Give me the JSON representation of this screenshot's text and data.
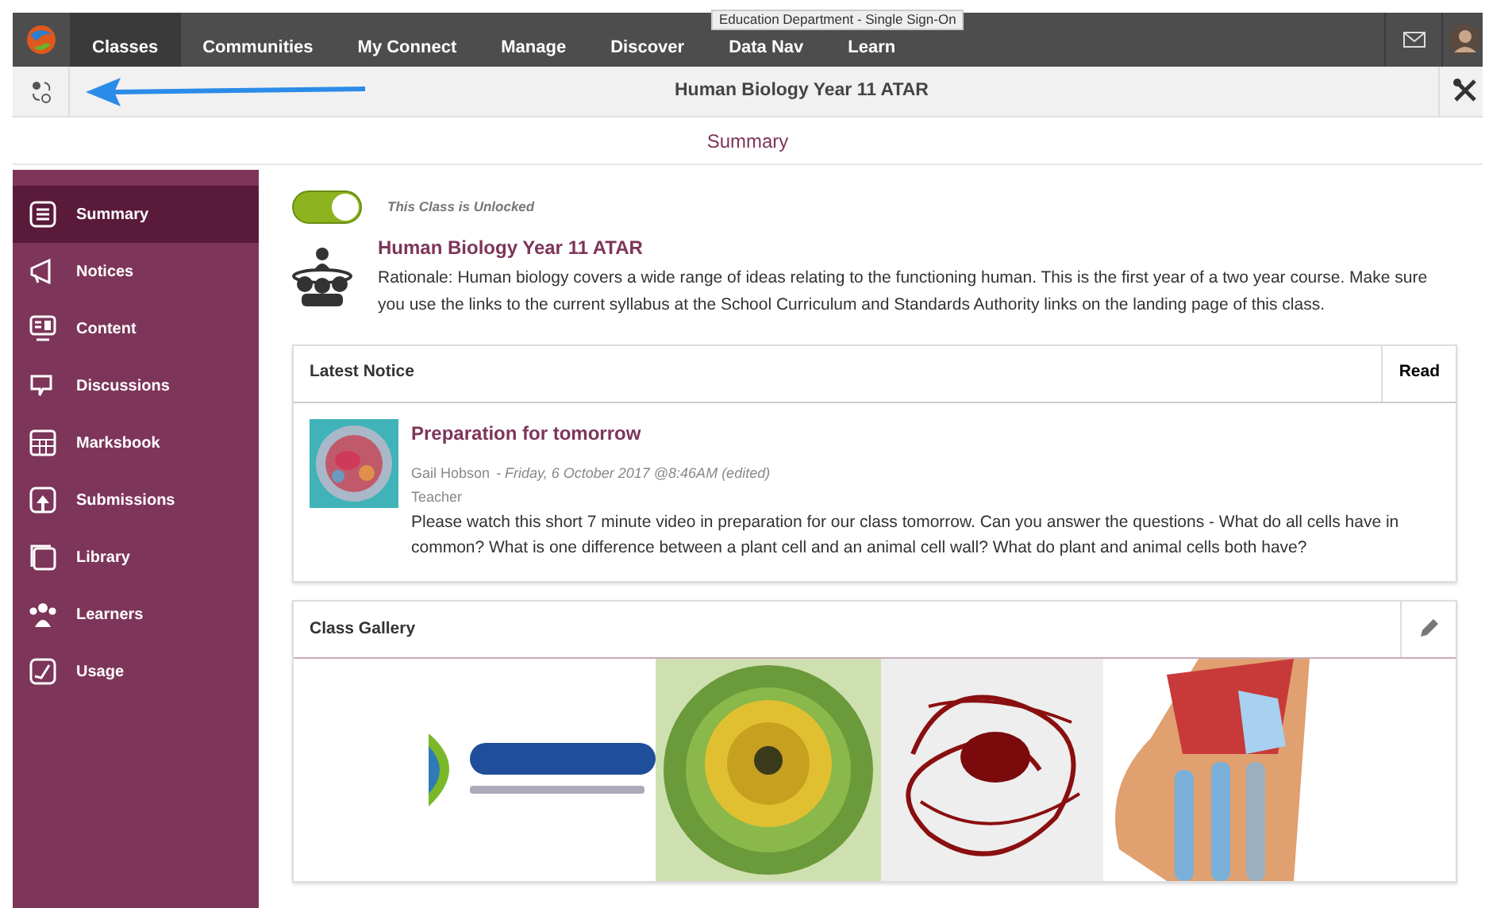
{
  "top_nav": {
    "items": [
      {
        "label": "Classes",
        "selected": true
      },
      {
        "label": "Communities",
        "selected": false
      },
      {
        "label": "My Connect",
        "selected": false
      },
      {
        "label": "Manage",
        "selected": false
      },
      {
        "label": "Discover",
        "selected": false
      },
      {
        "label": "Data Nav",
        "selected": false
      },
      {
        "label": "Learn",
        "selected": false
      }
    ],
    "tooltip": "Education Department - Single Sign-On"
  },
  "class_bar": {
    "title": "Human Biology Year 11 ATAR"
  },
  "page_title": "Summary",
  "sidebar": {
    "items": [
      {
        "label": "Summary",
        "selected": true
      },
      {
        "label": "Notices",
        "selected": false
      },
      {
        "label": "Content",
        "selected": false
      },
      {
        "label": "Discussions",
        "selected": false
      },
      {
        "label": "Marksbook",
        "selected": false
      },
      {
        "label": "Submissions",
        "selected": false
      },
      {
        "label": "Library",
        "selected": false
      },
      {
        "label": "Learners",
        "selected": false
      },
      {
        "label": "Usage",
        "selected": false
      }
    ]
  },
  "lock": {
    "on": true,
    "label": "This Class is Unlocked"
  },
  "class_info": {
    "title": "Human Biology Year 11 ATAR",
    "rationale": "Rationale: Human biology covers a wide range of ideas relating to the functioning human. This is the first year of a two year course.  Make sure you use the links to the current syllabus at the School Curriculum and Standards Authority links on the landing page of this class."
  },
  "latest_notice": {
    "heading": "Latest Notice",
    "action": "Read",
    "title": "Preparation for tomorrow",
    "author": "Gail Hobson",
    "date": "- Friday, 6 October 2017 @8:46AM  (edited)",
    "role": "Teacher",
    "body": "Please watch this short 7 minute video in preparation for our class tomorrow. Can you answer the questions - What do all cells have in common? What is one difference between a plant cell and an animal cell wall? What do plant and animal cells both have?"
  },
  "gallery": {
    "heading": "Class Gallery"
  }
}
